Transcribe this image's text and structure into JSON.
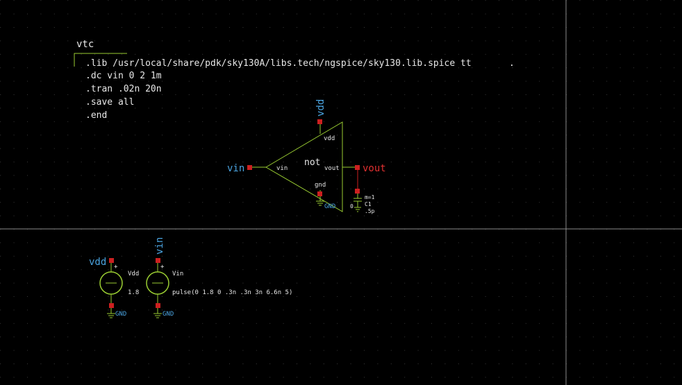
{
  "colors": {
    "background": "#000000",
    "grid_dot": "#3a3a3a",
    "origin_axis": "#8a8a8a",
    "symbol": "#9acd32",
    "text": "#e8e8e8",
    "net_label_input": "#4aa3df",
    "net_label_output": "#e03030",
    "pin": "#cc2020",
    "gnd_label": "#4aa3df"
  },
  "code_block": {
    "title": "vtc",
    "lines": [
      ".lib /usr/local/share/pdk/sky130A/libs.tech/ngspice/sky130.lib.spice tt",
      ".dc vin 0 2 1m",
      ".tran .02n 20n",
      ".save all",
      ".end"
    ]
  },
  "inverter": {
    "name": "not",
    "pins": {
      "vdd": "vdd",
      "vin": "vin",
      "vout": "vout",
      "gnd": "gnd"
    },
    "labels": {
      "vdd": "vdd",
      "vin": "vin",
      "vout": "vout"
    },
    "ground": "GND"
  },
  "capacitor": {
    "ref": "C1",
    "mult": "m=1",
    "value": ".5p",
    "node": "0"
  },
  "sources": {
    "vdd": {
      "ref": "Vdd",
      "net": "vdd",
      "value": "1.8",
      "plus": "+",
      "ground": "GND"
    },
    "vin": {
      "ref": "Vin",
      "net": "vin",
      "value": "pulse(0 1.8 0 .3n .3n 3n 6.6n 5)",
      "plus": "+",
      "ground": "GND"
    }
  }
}
